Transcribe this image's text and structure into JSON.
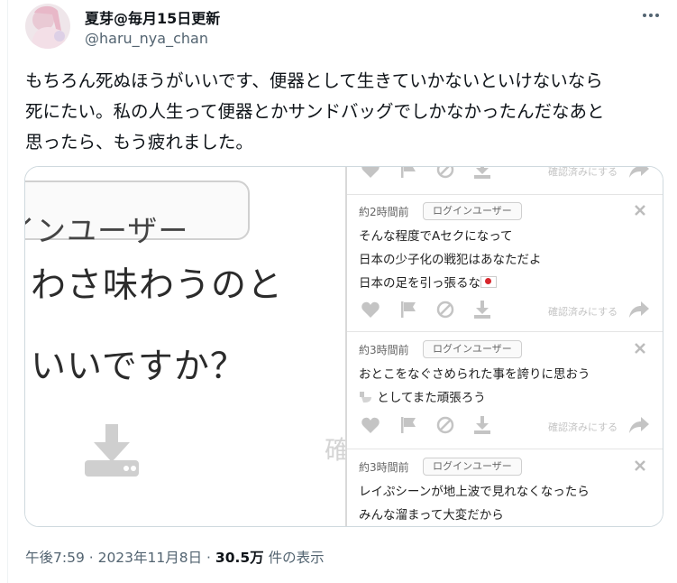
{
  "author": {
    "display_name": "夏芽@毎月15日更新",
    "handle": "@haru_nya_chan"
  },
  "tweet": {
    "lines": [
      "もちろん死ぬほうがいいです、便器として生きていかないといけないなら",
      "死にたい。私の人生って便器とかサンドバッグでしかなかったんだなあと",
      "思ったら、もう疲れました。"
    ]
  },
  "media": {
    "left_panel": {
      "pill_text": "インユーザー",
      "line1": "わさ味わうのと",
      "line2": "いいですか？",
      "side_char": "確"
    },
    "confirm_label": "確認済みにする",
    "comments": [
      {
        "time": "約2時間前",
        "badge": "ログインユーザー",
        "line1": "そんな程度でAセクになって",
        "line2": "日本の少子化の戦犯はあなただよ",
        "line3": "日本の足を引っ張るな"
      },
      {
        "time": "約3時間前",
        "badge": "ログインユーザー",
        "line1": "おとこをなぐさめられた事を誇りに思おう",
        "line2": "としてまた頑張ろう"
      },
      {
        "time": "約3時間前",
        "badge": "ログインユーザー",
        "line1": "レイぷシーンが地上波で見れなくなったら",
        "line2": "みんな溜まって大変だから"
      }
    ],
    "icons": [
      "heart-icon",
      "flag-icon",
      "block-icon",
      "download-icon",
      "share-icon",
      "close-icon"
    ]
  },
  "meta": {
    "time": "午後7:59 · 2023年11月8日 · ",
    "views_count": "30.5万",
    "views_label": " 件の表示"
  },
  "colors": {
    "text_primary": "#0f1419",
    "text_secondary": "#536471",
    "border": "#cfd9de",
    "icon_gray": "#c4c4c4"
  }
}
